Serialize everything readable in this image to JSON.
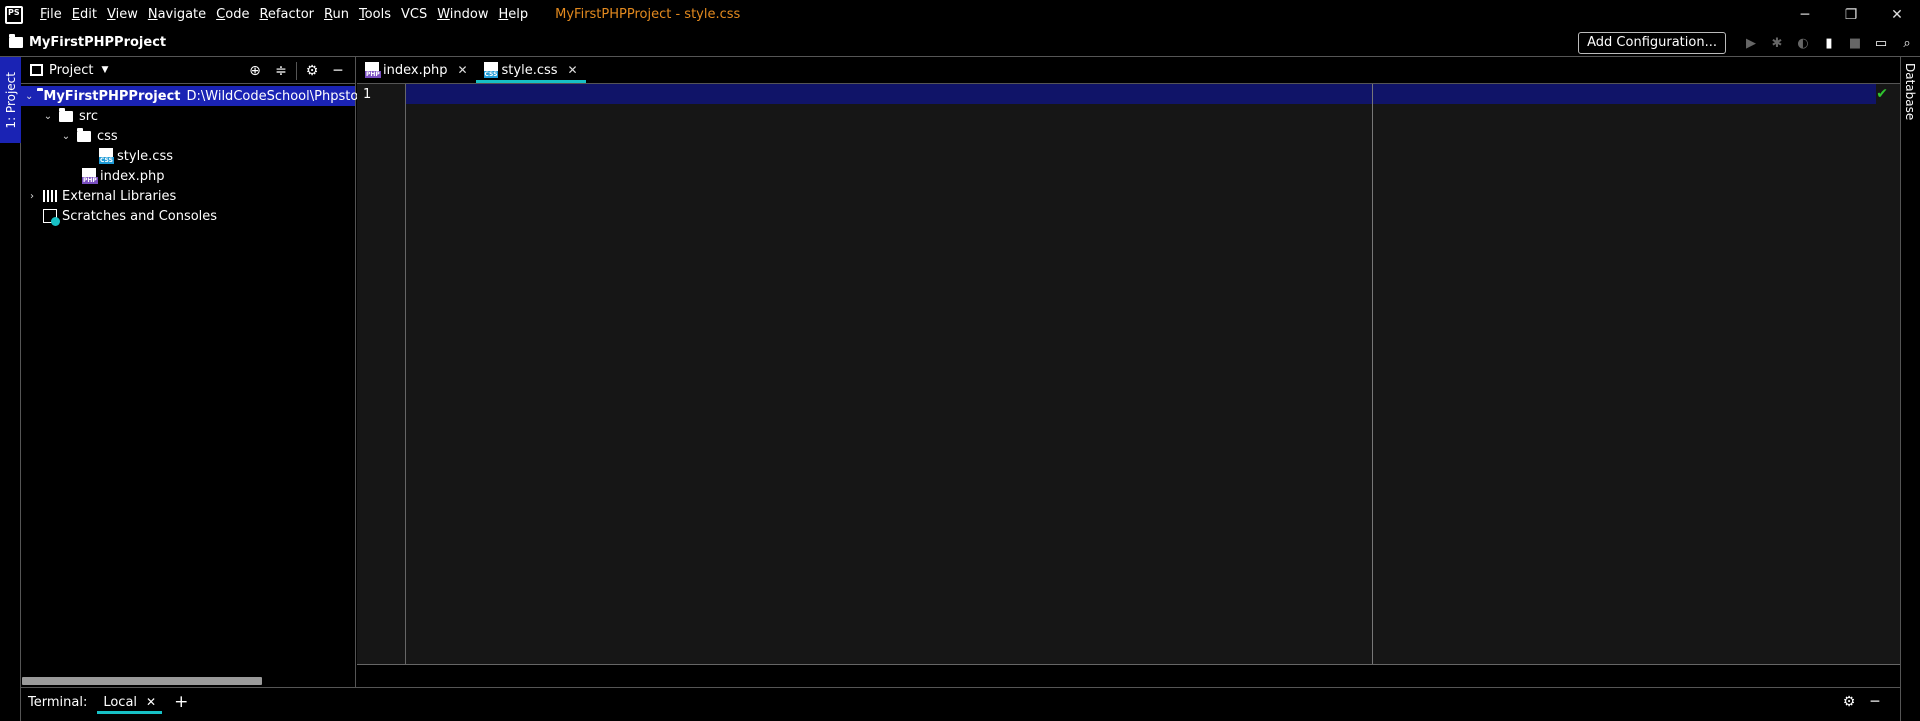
{
  "app": {
    "logo_text": "PS",
    "window_title": "MyFirstPHPProject - style.css",
    "title_color": "#e38a1f",
    "accent_color": "#1a23b4",
    "tab_underline_color": "#17c1c6"
  },
  "menu": [
    {
      "u": "F",
      "rest": "ile"
    },
    {
      "u": "E",
      "rest": "dit"
    },
    {
      "u": "V",
      "rest": "iew"
    },
    {
      "u": "N",
      "rest": "avigate"
    },
    {
      "u": "C",
      "rest": "ode"
    },
    {
      "u": "R",
      "rest": "efactor"
    },
    {
      "u": "R",
      "rest": "un",
      "pre": ""
    },
    {
      "u": "T",
      "rest": "ools"
    },
    {
      "u": "",
      "rest": "VCS"
    },
    {
      "u": "W",
      "rest": "indow"
    },
    {
      "u": "H",
      "rest": "elp"
    }
  ],
  "window_controls": {
    "minimize": "─",
    "restore": "❐",
    "close": "✕"
  },
  "navbar": {
    "project": "MyFirstPHPProject",
    "add_config": "Add Configuration..."
  },
  "left_strip": {
    "tab": "1: Project"
  },
  "right_strip": {
    "tab": "Database"
  },
  "project_panel": {
    "title": "Project",
    "tree": [
      {
        "label": "MyFirstPHPProject",
        "path": "D:\\WildCodeSchool\\PhpstormProj",
        "type": "folder",
        "expanded": true,
        "selected": true
      },
      {
        "label": "src",
        "type": "folder",
        "expanded": true
      },
      {
        "label": "css",
        "type": "folder",
        "expanded": true
      },
      {
        "label": "style.css",
        "type": "css"
      },
      {
        "label": "index.php",
        "type": "php"
      },
      {
        "label": "External Libraries",
        "type": "libraries",
        "expanded": false
      },
      {
        "label": "Scratches and Consoles",
        "type": "scratches"
      }
    ]
  },
  "editor": {
    "tabs": [
      {
        "label": "index.php",
        "type": "php",
        "active": false
      },
      {
        "label": "style.css",
        "type": "css",
        "active": true
      }
    ],
    "line_numbers": [
      "1"
    ]
  },
  "terminal": {
    "label": "Terminal:",
    "tab": "Local",
    "add": "+"
  }
}
